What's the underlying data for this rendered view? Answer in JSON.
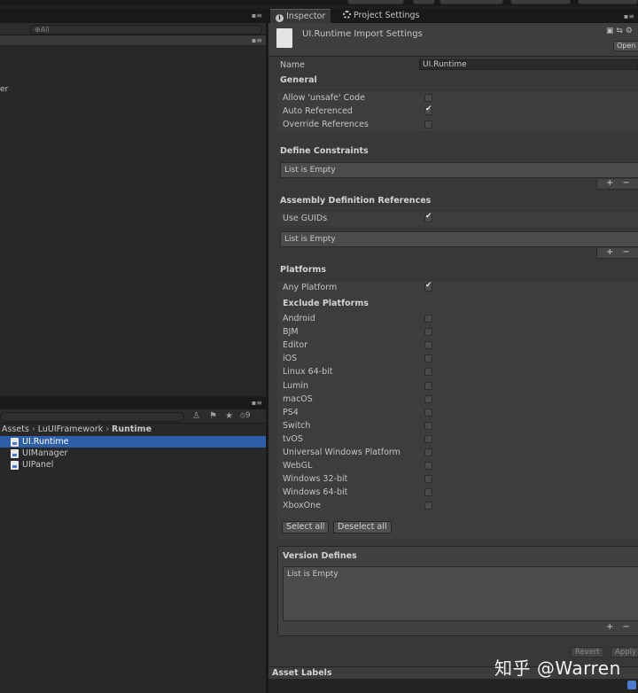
{
  "left_top": {
    "search_placeholder": "⊕All",
    "partial_item": "er",
    "menu": "▪≡"
  },
  "left_bottom": {
    "menu": "▪≡",
    "toolbar_count": "⦸9",
    "breadcrumb": [
      "Assets",
      "LuUIFramework",
      "Runtime"
    ],
    "breadcrumb_sep": "›",
    "assets": [
      {
        "name": "UI.Runtime",
        "selected": true
      },
      {
        "name": "UIManager",
        "selected": false
      },
      {
        "name": "UIPanel",
        "selected": false
      }
    ]
  },
  "inspector": {
    "tabs": [
      {
        "label": "Inspector",
        "icon": "info-icon",
        "glyph": "i"
      },
      {
        "label": "Project Settings",
        "icon": "gear-icon"
      }
    ],
    "tab_menu": "▪≡",
    "title": "UI.Runtime Import Settings",
    "header_icons": "▣ ⇆ ⚙",
    "open_label": "Open",
    "name_label": "Name",
    "name_value": "UI.Runtime",
    "general": {
      "heading": "General",
      "options": [
        {
          "label": "Allow 'unsafe' Code",
          "checked": false
        },
        {
          "label": "Auto Referenced",
          "checked": true
        },
        {
          "label": "Override References",
          "checked": false
        }
      ]
    },
    "define_constraints": {
      "heading": "Define Constraints",
      "list_text": "List is Empty"
    },
    "assembly_refs": {
      "heading": "Assembly Definition References",
      "use_guids_label": "Use GUIDs",
      "use_guids_checked": true,
      "list_text": "List is Empty"
    },
    "list_add": "+",
    "list_remove": "−",
    "platforms": {
      "heading": "Platforms",
      "any_platform_label": "Any Platform",
      "any_platform_checked": true,
      "exclude_heading": "Exclude Platforms",
      "list": [
        "Android",
        "BJM",
        "Editor",
        "iOS",
        "Linux 64-bit",
        "Lumin",
        "macOS",
        "PS4",
        "Switch",
        "tvOS",
        "Universal Windows Platform",
        "WebGL",
        "Windows 32-bit",
        "Windows 64-bit",
        "XboxOne"
      ],
      "select_all": "Select all",
      "deselect_all": "Deselect all"
    },
    "version_defines": {
      "heading": "Version Defines",
      "list_text": "List is Empty"
    },
    "revert": "Revert",
    "apply": "Apply",
    "asset_labels": "Asset Labels"
  },
  "watermark": "知乎 @Warren"
}
